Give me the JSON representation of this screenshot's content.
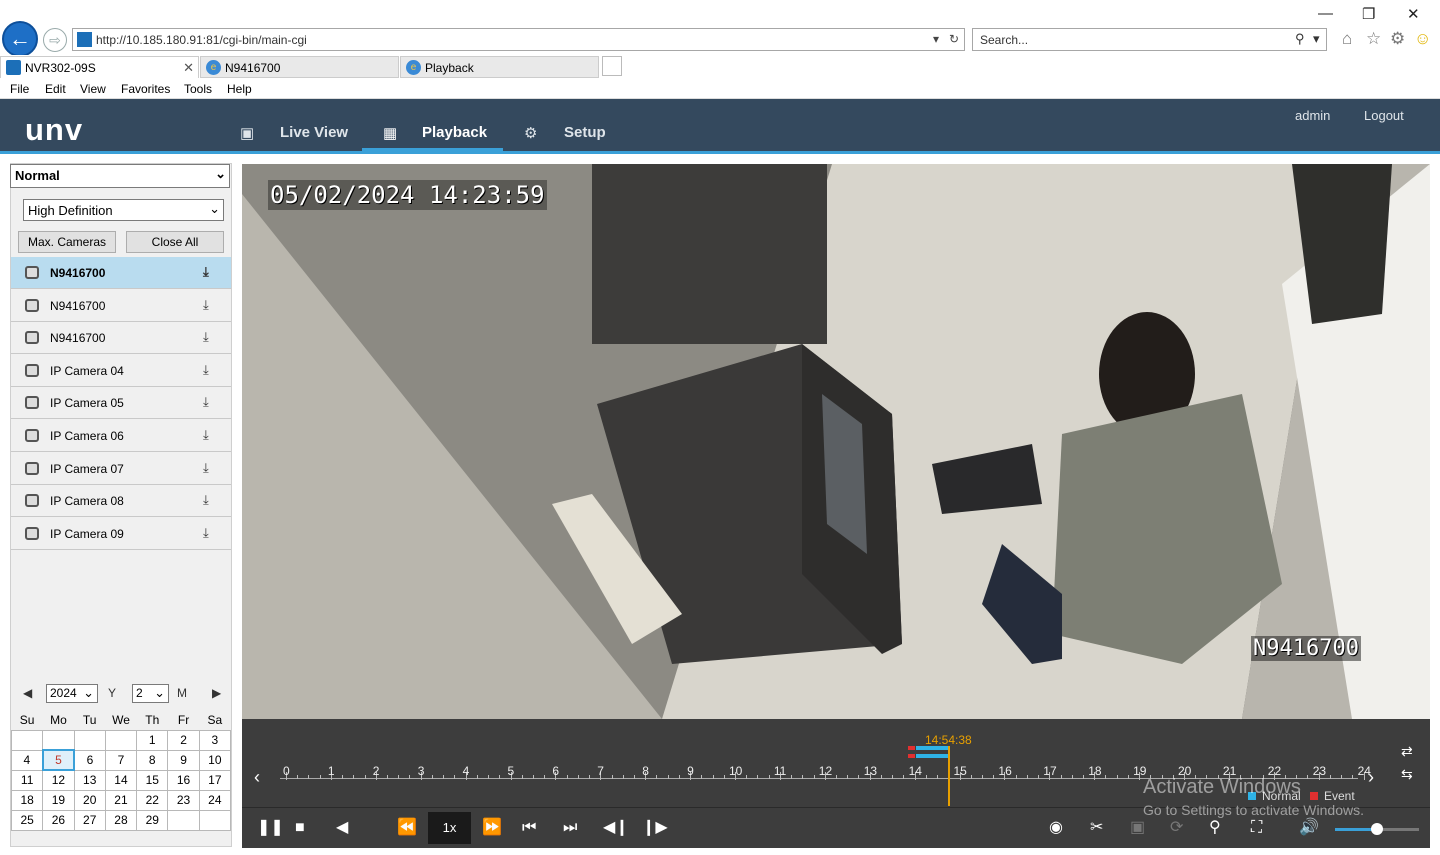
{
  "browser": {
    "url": "http://10.185.180.91:81/cgi-bin/main-cgi",
    "search_placeholder": "Search...",
    "tabs": [
      {
        "label": "NVR302-09S"
      },
      {
        "label": "N9416700"
      },
      {
        "label": "Playback"
      }
    ],
    "menu": [
      "File",
      "Edit",
      "View",
      "Favorites",
      "Tools",
      "Help"
    ]
  },
  "app": {
    "logo": "unv",
    "nav": {
      "live_view": "Live View",
      "playback": "Playback",
      "setup": "Setup"
    },
    "user": "admin",
    "logout": "Logout"
  },
  "left_panel": {
    "mode": "Normal",
    "quality": "High Definition",
    "max_cameras": "Max. Cameras",
    "close_all": "Close All",
    "cameras": [
      "N9416700",
      "N9416700",
      "N9416700",
      "IP Camera 04",
      "IP Camera 05",
      "IP Camera 06",
      "IP Camera 07",
      "IP Camera 08",
      "IP Camera 09"
    ],
    "calendar": {
      "year": "2024",
      "year_label": "Y",
      "month": "2",
      "month_label": "M",
      "weekdays": [
        "Su",
        "Mo",
        "Tu",
        "We",
        "Th",
        "Fr",
        "Sa"
      ],
      "weeks": [
        [
          "",
          "",
          "",
          "",
          "1",
          "2",
          "3"
        ],
        [
          "4",
          "5",
          "6",
          "7",
          "8",
          "9",
          "10"
        ],
        [
          "11",
          "12",
          "13",
          "14",
          "15",
          "16",
          "17"
        ],
        [
          "18",
          "19",
          "20",
          "21",
          "22",
          "23",
          "24"
        ],
        [
          "25",
          "26",
          "27",
          "28",
          "29",
          "",
          ""
        ]
      ],
      "selected_day": "5"
    }
  },
  "video": {
    "osd_time": "05/02/2024 14:23:59",
    "osd_name": "N9416700"
  },
  "timeline": {
    "current_time": "14:54:38",
    "hours": [
      "0",
      "1",
      "2",
      "3",
      "4",
      "5",
      "6",
      "7",
      "8",
      "9",
      "10",
      "11",
      "12",
      "13",
      "14",
      "15",
      "16",
      "17",
      "18",
      "19",
      "20",
      "21",
      "22",
      "23",
      "24"
    ],
    "legend_normal": "Normal",
    "legend_event": "Event",
    "normal_color": "#2fb3e6",
    "event_color": "#e03030"
  },
  "controls": {
    "speed": "1x",
    "volume_level": 0.5
  },
  "watermark": {
    "line1": "Activate Windows",
    "line2": "Go to Settings to activate Windows."
  }
}
